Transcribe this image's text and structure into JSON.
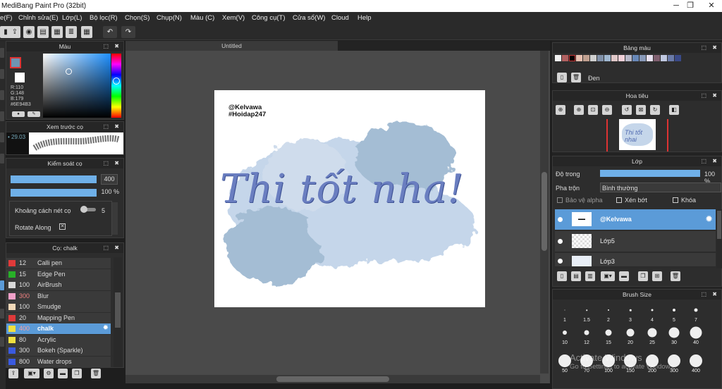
{
  "window": {
    "title": "MediBang Paint Pro (32bit)"
  },
  "menu": [
    "e(F)",
    "Chỉnh sửa(E)",
    "Lớp(L)",
    "Bộ lọc(R)",
    "Chọn(S)",
    "Chụp(N)",
    "Màu (C)",
    "Xem(V)",
    "Công cụ(T)",
    "Cửa sổ(W)",
    "Cloud",
    "Help"
  ],
  "color_panel": {
    "title": "Màu",
    "r": "R:110",
    "g": "G:148",
    "b": "B:179",
    "hex": "#6E94B3"
  },
  "brush_preview": {
    "title": "Xem trước cọ",
    "size": "29.03"
  },
  "brush_control": {
    "title": "Kiểm soát cọ",
    "size": "400",
    "opacity": "100 %",
    "spacing_label": "Khoảng cách nét cọ",
    "spacing_value": "5",
    "rotate_label": "Rotate Along"
  },
  "brush_list": {
    "title": "Cọ: chalk",
    "items": [
      {
        "num": "12",
        "label": "Calli pen",
        "color": "#e03a3a"
      },
      {
        "num": "15",
        "label": "Edge Pen",
        "color": "#28b028"
      },
      {
        "num": "100",
        "label": "AirBrush",
        "color": "#d8d8d8"
      },
      {
        "num": "300",
        "label": "Blur",
        "color": "#f0a0c8"
      },
      {
        "num": "100",
        "label": "Smudge",
        "color": "#f0d8b8"
      },
      {
        "num": "20",
        "label": "Mapping Pen",
        "color": "#e03a3a"
      },
      {
        "num": "400",
        "label": "chalk",
        "color": "#f0e040"
      },
      {
        "num": "80",
        "label": "Acrylic",
        "color": "#f0e040"
      },
      {
        "num": "300",
        "label": "Bokeh (Sparkle)",
        "color": "#3a5ae0"
      },
      {
        "num": "800",
        "label": "Water drops",
        "color": "#3a5ae0"
      }
    ]
  },
  "document": {
    "tab": "Untitled",
    "watermark1": "@Kelvawa",
    "watermark2": "#Hoidap247",
    "text": "Thi tốt nha!"
  },
  "palette": {
    "title": "Bảng màu",
    "color_name": "Đen",
    "colors": [
      "#f0f0f0",
      "#b06060",
      "#000000",
      "#e8c0b0",
      "#c0a090",
      "#d0d0d0",
      "#8090a8",
      "#a0b8d0",
      "#e0c8c8",
      "#f0d0d8",
      "#b8b8c8",
      "#6888b8",
      "#8898b8",
      "#e8e0f0",
      "#806070",
      "#c0c8e0",
      "#6a7aa8",
      "#3a4a88"
    ]
  },
  "navigator": {
    "title": "Hoa tiêu"
  },
  "layers": {
    "title": "Lớp",
    "opacity_label": "Độ trong",
    "opacity_value": "100 %",
    "blend_label": "Pha trộn",
    "blend_value": "Bình thường",
    "protect_alpha": "Bảo vệ alpha",
    "clip": "Xén bớt",
    "lock": "Khóa",
    "items": [
      {
        "name": "@Kelvawa"
      },
      {
        "name": "Lớp5"
      },
      {
        "name": "Lớp3"
      }
    ]
  },
  "brush_size": {
    "title": "Brush Size",
    "sizes": [
      "1",
      "1.5",
      "2",
      "3",
      "4",
      "5",
      "7",
      "10",
      "12",
      "15",
      "20",
      "25",
      "30",
      "40",
      "50",
      "70",
      "100",
      "150",
      "200",
      "300",
      "400"
    ]
  },
  "watermark_os": {
    "line1": "Activate Windows",
    "line2": "Go to Settings to activate Windows."
  }
}
